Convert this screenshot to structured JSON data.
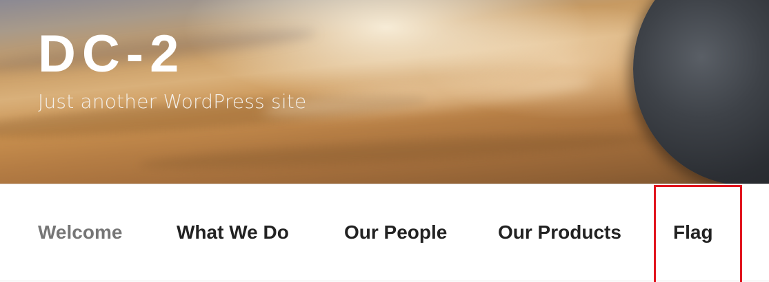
{
  "site": {
    "title": "DC-2",
    "description": "Just another WordPress site"
  },
  "nav": {
    "items": [
      {
        "label": "Welcome",
        "current": true
      },
      {
        "label": "What We Do"
      },
      {
        "label": "Our People"
      },
      {
        "label": "Our Products"
      },
      {
        "label": "Flag"
      }
    ]
  },
  "colors": {
    "highlight": "#e1151e",
    "nav_text": "#222222",
    "nav_current": "#767676"
  }
}
